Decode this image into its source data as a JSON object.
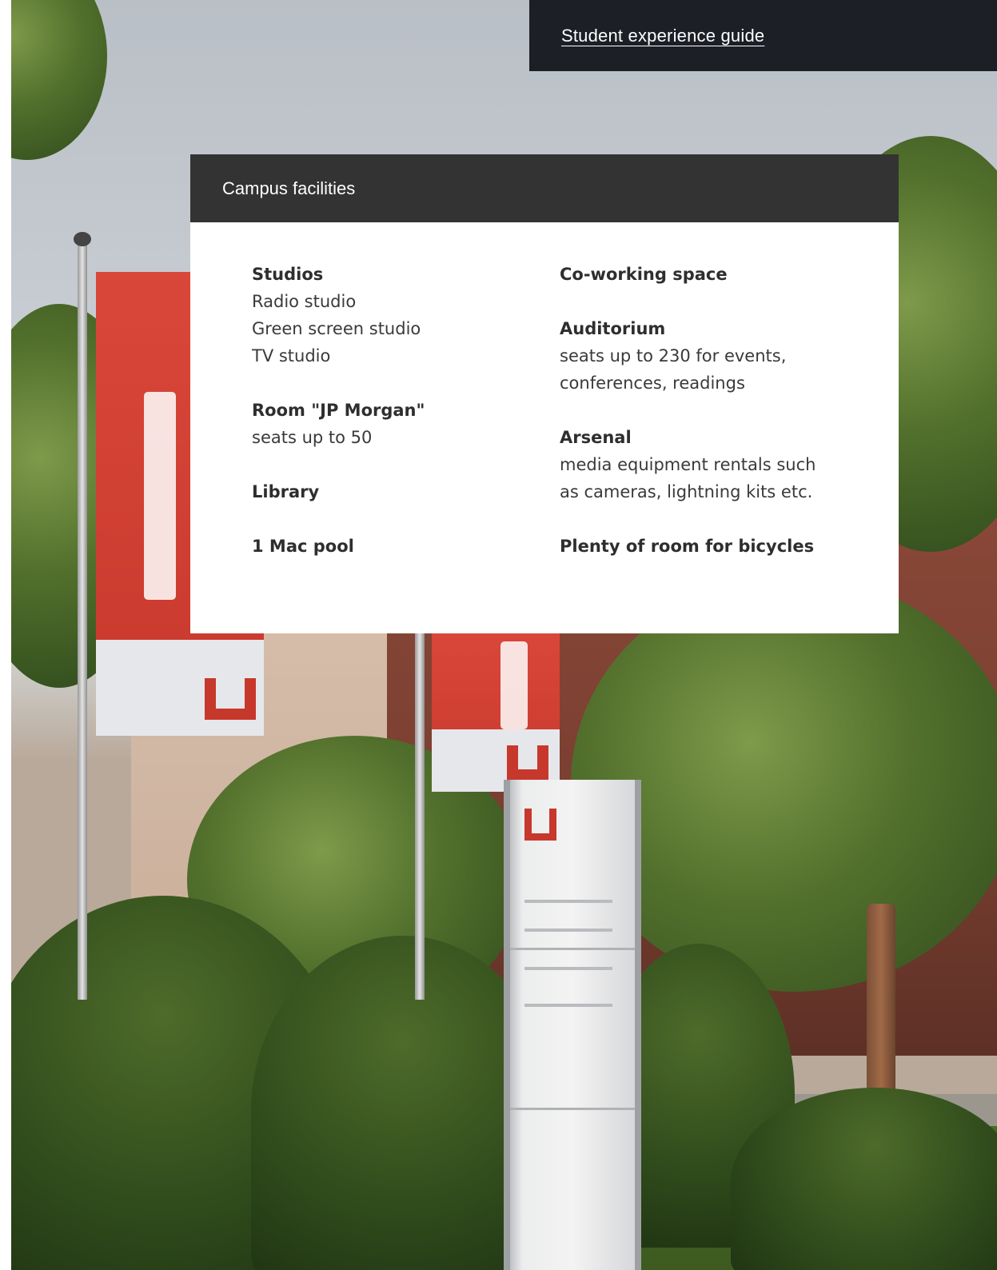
{
  "banner": {
    "link": "Student experience guide"
  },
  "card": {
    "title": "Campus facilities",
    "left": [
      {
        "name": "Studios",
        "lines": [
          "Radio studio",
          "Green screen studio",
          "TV studio"
        ]
      },
      {
        "name": "Room \"JP Morgan\"",
        "lines": [
          "seats up to 50"
        ]
      },
      {
        "name": "Library",
        "lines": []
      },
      {
        "name": "1 Mac pool",
        "lines": []
      }
    ],
    "right": [
      {
        "name": "Co-working space",
        "lines": []
      },
      {
        "name": "Auditorium",
        "lines": [
          "seats up to 230 for events,",
          "conferences, readings"
        ]
      },
      {
        "name": "Arsenal",
        "lines": [
          "media equipment rentals such",
          "as cameras, lightning kits etc."
        ]
      },
      {
        "name": "Plenty of room for bicycles",
        "lines": []
      }
    ]
  },
  "colors": {
    "banner": "#1d1f27",
    "card_header": "#333333",
    "brand_red": "#c7382c"
  }
}
